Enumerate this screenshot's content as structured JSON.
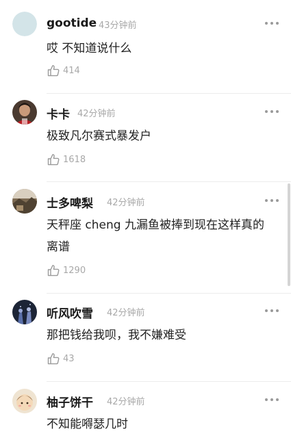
{
  "comments": [
    {
      "username": "gootide",
      "time": "43分钟前",
      "text": "哎 不知道说什么",
      "likes": "414"
    },
    {
      "username": "卡卡",
      "time": "42分钟前",
      "text": "极致凡尔赛式暴发户",
      "likes": "1618"
    },
    {
      "username": "士多啤梨",
      "time": "42分钟前",
      "text": "天秤座 cheng 九漏鱼被捧到现在这样真的离谱",
      "likes": "1290"
    },
    {
      "username": "听风吹雪",
      "time": "42分钟前",
      "text": "那把钱给我呗，我不嫌难受",
      "likes": "43"
    },
    {
      "username": "柚子饼干",
      "time": "42分钟前",
      "text": "不知能嘚瑟几时",
      "likes": ""
    }
  ],
  "colors": {
    "text": "#222222",
    "meta": "#a8a8a8",
    "divider": "#ececec",
    "background": "#ffffff"
  },
  "icons": {
    "like": "thumbs-up-icon",
    "more": "more-dots-icon"
  }
}
